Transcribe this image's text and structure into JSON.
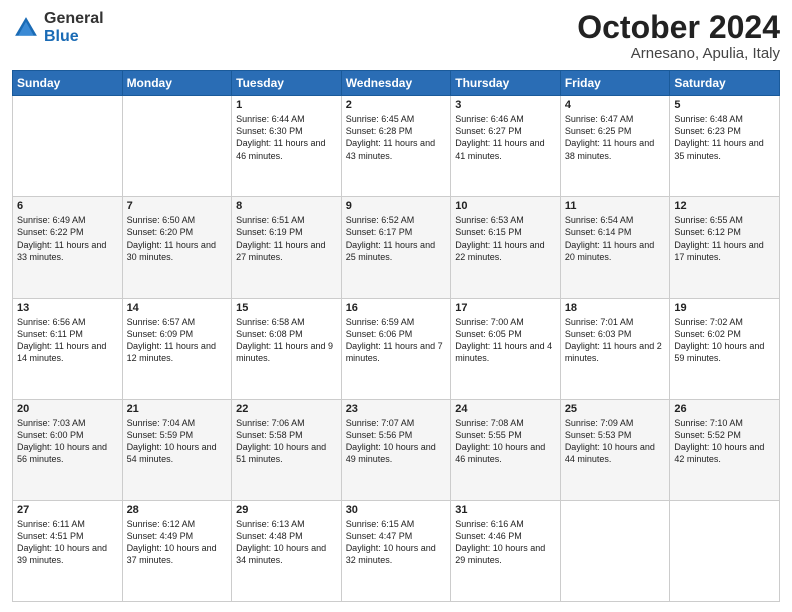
{
  "header": {
    "logo": {
      "general": "General",
      "blue": "Blue"
    },
    "title": "October 2024",
    "location": "Arnesano, Apulia, Italy"
  },
  "days_of_week": [
    "Sunday",
    "Monday",
    "Tuesday",
    "Wednesday",
    "Thursday",
    "Friday",
    "Saturday"
  ],
  "weeks": [
    [
      {
        "day": null,
        "info": null
      },
      {
        "day": null,
        "info": null
      },
      {
        "day": "1",
        "info": "Sunrise: 6:44 AM\nSunset: 6:30 PM\nDaylight: 11 hours and 46 minutes."
      },
      {
        "day": "2",
        "info": "Sunrise: 6:45 AM\nSunset: 6:28 PM\nDaylight: 11 hours and 43 minutes."
      },
      {
        "day": "3",
        "info": "Sunrise: 6:46 AM\nSunset: 6:27 PM\nDaylight: 11 hours and 41 minutes."
      },
      {
        "day": "4",
        "info": "Sunrise: 6:47 AM\nSunset: 6:25 PM\nDaylight: 11 hours and 38 minutes."
      },
      {
        "day": "5",
        "info": "Sunrise: 6:48 AM\nSunset: 6:23 PM\nDaylight: 11 hours and 35 minutes."
      }
    ],
    [
      {
        "day": "6",
        "info": "Sunrise: 6:49 AM\nSunset: 6:22 PM\nDaylight: 11 hours and 33 minutes."
      },
      {
        "day": "7",
        "info": "Sunrise: 6:50 AM\nSunset: 6:20 PM\nDaylight: 11 hours and 30 minutes."
      },
      {
        "day": "8",
        "info": "Sunrise: 6:51 AM\nSunset: 6:19 PM\nDaylight: 11 hours and 27 minutes."
      },
      {
        "day": "9",
        "info": "Sunrise: 6:52 AM\nSunset: 6:17 PM\nDaylight: 11 hours and 25 minutes."
      },
      {
        "day": "10",
        "info": "Sunrise: 6:53 AM\nSunset: 6:15 PM\nDaylight: 11 hours and 22 minutes."
      },
      {
        "day": "11",
        "info": "Sunrise: 6:54 AM\nSunset: 6:14 PM\nDaylight: 11 hours and 20 minutes."
      },
      {
        "day": "12",
        "info": "Sunrise: 6:55 AM\nSunset: 6:12 PM\nDaylight: 11 hours and 17 minutes."
      }
    ],
    [
      {
        "day": "13",
        "info": "Sunrise: 6:56 AM\nSunset: 6:11 PM\nDaylight: 11 hours and 14 minutes."
      },
      {
        "day": "14",
        "info": "Sunrise: 6:57 AM\nSunset: 6:09 PM\nDaylight: 11 hours and 12 minutes."
      },
      {
        "day": "15",
        "info": "Sunrise: 6:58 AM\nSunset: 6:08 PM\nDaylight: 11 hours and 9 minutes."
      },
      {
        "day": "16",
        "info": "Sunrise: 6:59 AM\nSunset: 6:06 PM\nDaylight: 11 hours and 7 minutes."
      },
      {
        "day": "17",
        "info": "Sunrise: 7:00 AM\nSunset: 6:05 PM\nDaylight: 11 hours and 4 minutes."
      },
      {
        "day": "18",
        "info": "Sunrise: 7:01 AM\nSunset: 6:03 PM\nDaylight: 11 hours and 2 minutes."
      },
      {
        "day": "19",
        "info": "Sunrise: 7:02 AM\nSunset: 6:02 PM\nDaylight: 10 hours and 59 minutes."
      }
    ],
    [
      {
        "day": "20",
        "info": "Sunrise: 7:03 AM\nSunset: 6:00 PM\nDaylight: 10 hours and 56 minutes."
      },
      {
        "day": "21",
        "info": "Sunrise: 7:04 AM\nSunset: 5:59 PM\nDaylight: 10 hours and 54 minutes."
      },
      {
        "day": "22",
        "info": "Sunrise: 7:06 AM\nSunset: 5:58 PM\nDaylight: 10 hours and 51 minutes."
      },
      {
        "day": "23",
        "info": "Sunrise: 7:07 AM\nSunset: 5:56 PM\nDaylight: 10 hours and 49 minutes."
      },
      {
        "day": "24",
        "info": "Sunrise: 7:08 AM\nSunset: 5:55 PM\nDaylight: 10 hours and 46 minutes."
      },
      {
        "day": "25",
        "info": "Sunrise: 7:09 AM\nSunset: 5:53 PM\nDaylight: 10 hours and 44 minutes."
      },
      {
        "day": "26",
        "info": "Sunrise: 7:10 AM\nSunset: 5:52 PM\nDaylight: 10 hours and 42 minutes."
      }
    ],
    [
      {
        "day": "27",
        "info": "Sunrise: 6:11 AM\nSunset: 4:51 PM\nDaylight: 10 hours and 39 minutes."
      },
      {
        "day": "28",
        "info": "Sunrise: 6:12 AM\nSunset: 4:49 PM\nDaylight: 10 hours and 37 minutes."
      },
      {
        "day": "29",
        "info": "Sunrise: 6:13 AM\nSunset: 4:48 PM\nDaylight: 10 hours and 34 minutes."
      },
      {
        "day": "30",
        "info": "Sunrise: 6:15 AM\nSunset: 4:47 PM\nDaylight: 10 hours and 32 minutes."
      },
      {
        "day": "31",
        "info": "Sunrise: 6:16 AM\nSunset: 4:46 PM\nDaylight: 10 hours and 29 minutes."
      },
      {
        "day": null,
        "info": null
      },
      {
        "day": null,
        "info": null
      }
    ]
  ]
}
